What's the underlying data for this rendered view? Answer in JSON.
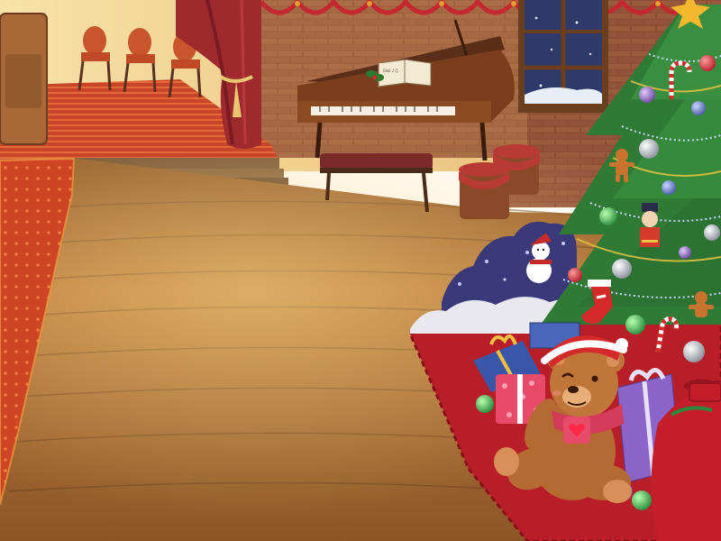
{
  "scene": {
    "setting": "christmas-music-room",
    "piano_sheet_music": {
      "title": "Ɛɑl ♪♫",
      "visible": true
    },
    "colors": {
      "floor": "#a86a32",
      "wall_brick": "#8a4a35",
      "curtain": "#9e2a2e",
      "carpet_red": "#c43a25",
      "tree_green": "#2f7a35",
      "teddy": "#b56a32"
    },
    "icons": [
      "christmas-tree-icon",
      "teddy-bear-icon",
      "grand-piano-icon",
      "present-icon",
      "window-icon",
      "curtain-icon",
      "candy-cane-icon",
      "gingerbread-man-icon",
      "stocking-icon",
      "nutcracker-icon",
      "snowman-icon",
      "santa-sack-icon"
    ]
  }
}
